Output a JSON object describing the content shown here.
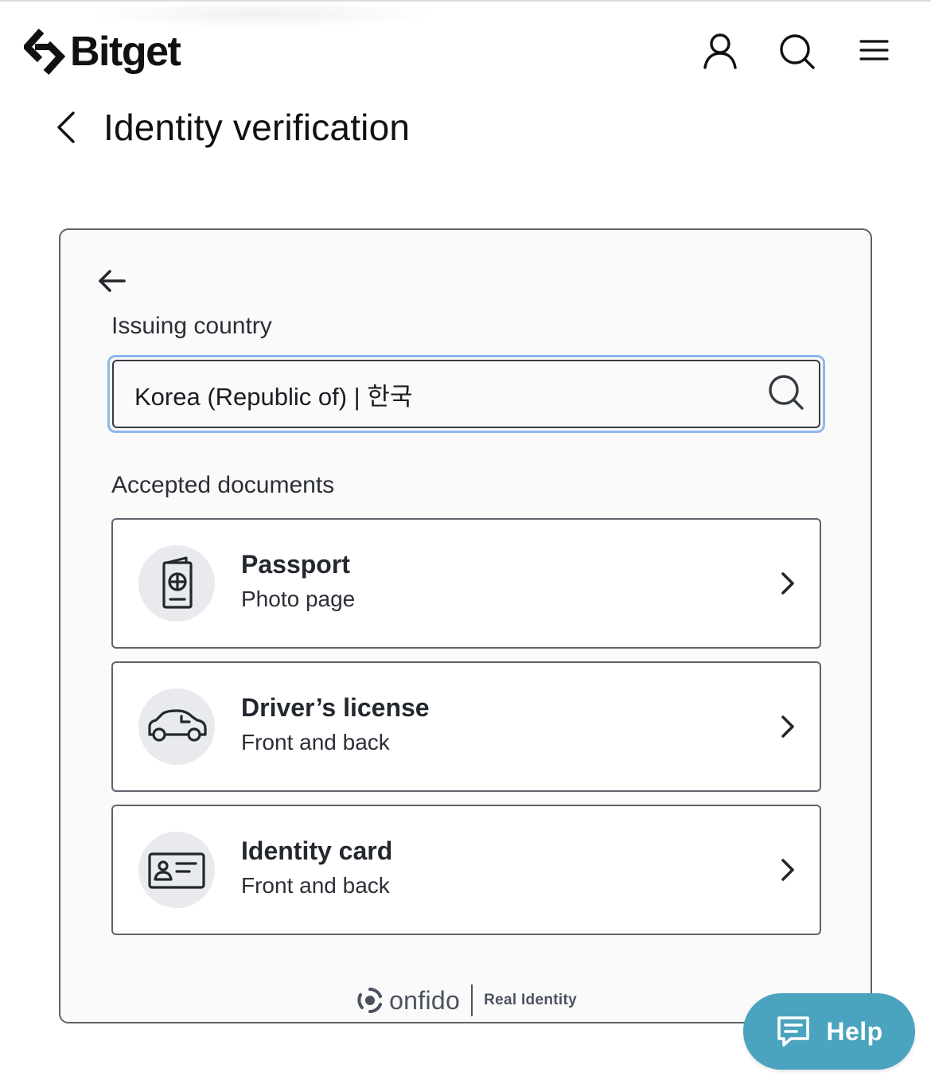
{
  "header": {
    "brand": "Bitget",
    "icons": [
      "user-icon",
      "search-icon",
      "menu-icon"
    ]
  },
  "page": {
    "title": "Identity verification"
  },
  "form": {
    "issuing_country_label": "Issuing country",
    "country_value": "Korea (Republic of) | 한국",
    "accepted_documents_label": "Accepted documents"
  },
  "documents": [
    {
      "title": "Passport",
      "subtitle": "Photo page",
      "icon": "passport-icon"
    },
    {
      "title": "Driver’s license",
      "subtitle": "Front and back",
      "icon": "car-icon"
    },
    {
      "title": "Identity card",
      "subtitle": "Front and back",
      "icon": "id-card-icon"
    }
  ],
  "footer": {
    "brand": "onfido",
    "tagline": "Real Identity"
  },
  "help": {
    "label": "Help"
  },
  "colors": {
    "focus_ring": "#8fb6ee",
    "help_button": "#4aa3bf",
    "icon_circle": "#e8eaee",
    "border": "#5f636b"
  }
}
